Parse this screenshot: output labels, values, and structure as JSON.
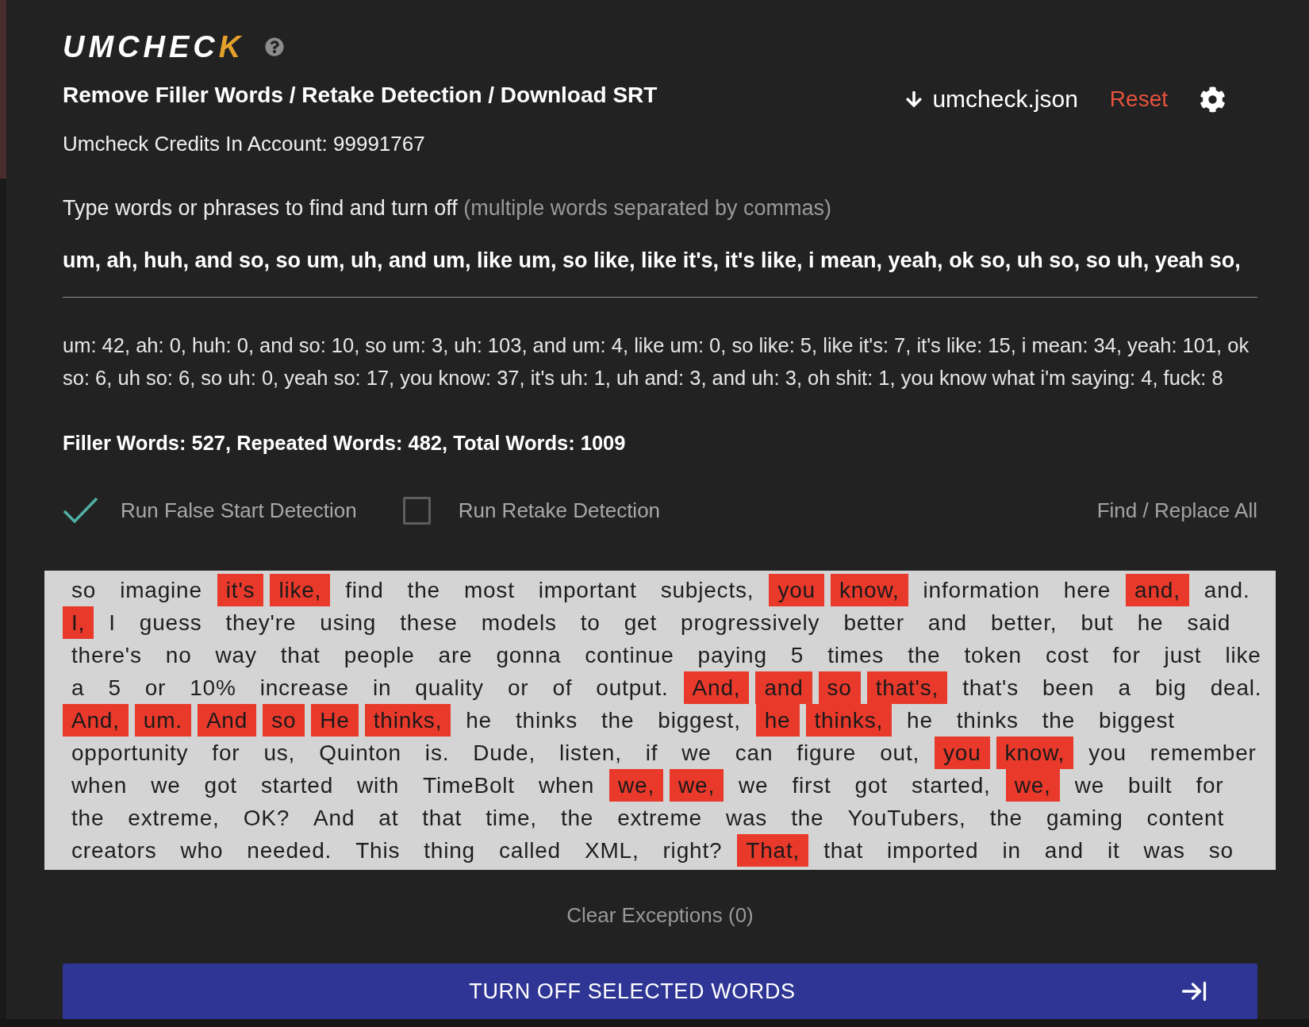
{
  "logo": {
    "text": "UMCHECK"
  },
  "header": {
    "title": "Remove Filler Words / Retake Detection / Download SRT",
    "download": {
      "label": "umcheck.json"
    },
    "reset": {
      "label": "Reset"
    }
  },
  "credits": "Umcheck Credits In Account: 99991767",
  "filter": {
    "label": "Type words or phrases to find and turn off",
    "hint": "(multiple words separated by commas)",
    "value": "um, ah, huh, and so, so um, uh, and um, like um, so like, like it's, it's like, i mean, yeah, ok so, uh so, so uh, yeah so,"
  },
  "counts": "um: 42, ah: 0, huh: 0, and so: 10, so um: 3, uh: 103, and um: 4, like um: 0, so like: 5, like it's: 7, it's like: 15, i mean: 34, yeah: 101, ok so: 6, uh so: 6, so uh: 0, yeah so: 17, you know: 37, it's uh: 1, uh and: 3, and uh: 3, oh shit: 1, you know what i'm saying: 4, fuck: 8",
  "summary": "Filler Words: 527, Repeated Words: 482, Total Words: 1009",
  "options": [
    {
      "label": "Run False Start Detection",
      "checked": true
    },
    {
      "label": "Run Retake Detection",
      "checked": false
    }
  ],
  "find_replace": "Find / Replace All",
  "transcript": {
    "lines": [
      {
        "words": [
          {
            "text": "so",
            "selected": false
          },
          {
            "text": "imagine",
            "selected": false
          },
          {
            "text": "it's",
            "selected": true
          },
          {
            "text": "like,",
            "selected": true
          },
          {
            "text": "find",
            "selected": false
          },
          {
            "text": "the",
            "selected": false
          },
          {
            "text": "most",
            "selected": false
          },
          {
            "text": "important",
            "selected": false
          },
          {
            "text": "subjects,",
            "selected": false
          },
          {
            "text": "you",
            "selected": true
          },
          {
            "text": "know,",
            "selected": true
          },
          {
            "text": "information",
            "selected": false
          },
          {
            "text": "here",
            "selected": false
          },
          {
            "text": "and,",
            "selected": true
          },
          {
            "text": "and.",
            "selected": false
          }
        ]
      },
      {
        "words": [
          {
            "text": "I,",
            "selected": true
          },
          {
            "text": "I",
            "selected": false
          },
          {
            "text": "guess",
            "selected": false
          },
          {
            "text": "they're",
            "selected": false
          },
          {
            "text": "using",
            "selected": false
          },
          {
            "text": "these",
            "selected": false
          },
          {
            "text": "models",
            "selected": false
          },
          {
            "text": "to",
            "selected": false
          },
          {
            "text": "get",
            "selected": false
          },
          {
            "text": "progressively",
            "selected": false
          },
          {
            "text": "better",
            "selected": false
          },
          {
            "text": "and",
            "selected": false
          },
          {
            "text": "better,",
            "selected": false
          },
          {
            "text": "but",
            "selected": false
          },
          {
            "text": "he",
            "selected": false
          },
          {
            "text": "said",
            "selected": false
          }
        ]
      },
      {
        "words": [
          {
            "text": "there's",
            "selected": false
          },
          {
            "text": "no",
            "selected": false
          },
          {
            "text": "way",
            "selected": false
          },
          {
            "text": "that",
            "selected": false
          },
          {
            "text": "people",
            "selected": false
          },
          {
            "text": "are",
            "selected": false
          },
          {
            "text": "gonna",
            "selected": false
          },
          {
            "text": "continue",
            "selected": false
          },
          {
            "text": "paying",
            "selected": false
          },
          {
            "text": "5",
            "selected": false
          },
          {
            "text": "times",
            "selected": false
          },
          {
            "text": "the",
            "selected": false
          },
          {
            "text": "token",
            "selected": false
          },
          {
            "text": "cost",
            "selected": false
          },
          {
            "text": "for",
            "selected": false
          },
          {
            "text": "just",
            "selected": false
          },
          {
            "text": "like",
            "selected": false
          }
        ]
      },
      {
        "words": [
          {
            "text": "a",
            "selected": false
          },
          {
            "text": "5",
            "selected": false
          },
          {
            "text": "or",
            "selected": false
          },
          {
            "text": "10%",
            "selected": false
          },
          {
            "text": "increase",
            "selected": false
          },
          {
            "text": "in",
            "selected": false
          },
          {
            "text": "quality",
            "selected": false
          },
          {
            "text": "or",
            "selected": false
          },
          {
            "text": "of",
            "selected": false
          },
          {
            "text": "output.",
            "selected": false
          },
          {
            "text": "And,",
            "selected": true
          },
          {
            "text": "and",
            "selected": true
          },
          {
            "text": "so",
            "selected": true
          },
          {
            "text": "that's,",
            "selected": true
          },
          {
            "text": "that's",
            "selected": false
          },
          {
            "text": "been",
            "selected": false
          },
          {
            "text": "a",
            "selected": false
          },
          {
            "text": "big",
            "selected": false
          },
          {
            "text": "deal.",
            "selected": false
          }
        ]
      },
      {
        "words": [
          {
            "text": "And,",
            "selected": true
          },
          {
            "text": "um.",
            "selected": true
          },
          {
            "text": "And",
            "selected": true
          },
          {
            "text": "so",
            "selected": true
          },
          {
            "text": "He",
            "selected": true
          },
          {
            "text": "thinks,",
            "selected": true
          },
          {
            "text": "he",
            "selected": false
          },
          {
            "text": "thinks",
            "selected": false
          },
          {
            "text": "the",
            "selected": false
          },
          {
            "text": "biggest,",
            "selected": false
          },
          {
            "text": "he",
            "selected": true
          },
          {
            "text": "thinks,",
            "selected": true
          },
          {
            "text": "he",
            "selected": false
          },
          {
            "text": "thinks",
            "selected": false
          },
          {
            "text": "the",
            "selected": false
          },
          {
            "text": "biggest",
            "selected": false
          }
        ]
      },
      {
        "words": [
          {
            "text": "opportunity",
            "selected": false
          },
          {
            "text": "for",
            "selected": false
          },
          {
            "text": "us,",
            "selected": false
          },
          {
            "text": "Quinton",
            "selected": false
          },
          {
            "text": "is.",
            "selected": false
          },
          {
            "text": "Dude,",
            "selected": false
          },
          {
            "text": "listen,",
            "selected": false
          },
          {
            "text": "if",
            "selected": false
          },
          {
            "text": "we",
            "selected": false
          },
          {
            "text": "can",
            "selected": false
          },
          {
            "text": "figure",
            "selected": false
          },
          {
            "text": "out,",
            "selected": false
          },
          {
            "text": "you",
            "selected": true
          },
          {
            "text": "know,",
            "selected": true
          },
          {
            "text": "you",
            "selected": false
          },
          {
            "text": "remember",
            "selected": false
          }
        ]
      },
      {
        "words": [
          {
            "text": "when",
            "selected": false
          },
          {
            "text": "we",
            "selected": false
          },
          {
            "text": "got",
            "selected": false
          },
          {
            "text": "started",
            "selected": false
          },
          {
            "text": "with",
            "selected": false
          },
          {
            "text": "TimeBolt",
            "selected": false
          },
          {
            "text": "when",
            "selected": false
          },
          {
            "text": "we,",
            "selected": true
          },
          {
            "text": "we,",
            "selected": true
          },
          {
            "text": "we",
            "selected": false
          },
          {
            "text": "first",
            "selected": false
          },
          {
            "text": "got",
            "selected": false
          },
          {
            "text": "started,",
            "selected": false
          },
          {
            "text": "we,",
            "selected": true
          },
          {
            "text": "we",
            "selected": false
          },
          {
            "text": "built",
            "selected": false
          },
          {
            "text": "for",
            "selected": false
          }
        ]
      },
      {
        "words": [
          {
            "text": "the",
            "selected": false
          },
          {
            "text": "extreme,",
            "selected": false
          },
          {
            "text": "OK?",
            "selected": false
          },
          {
            "text": "And",
            "selected": false
          },
          {
            "text": "at",
            "selected": false
          },
          {
            "text": "that",
            "selected": false
          },
          {
            "text": "time,",
            "selected": false
          },
          {
            "text": "the",
            "selected": false
          },
          {
            "text": "extreme",
            "selected": false
          },
          {
            "text": "was",
            "selected": false
          },
          {
            "text": "the",
            "selected": false
          },
          {
            "text": "YouTubers,",
            "selected": false
          },
          {
            "text": "the",
            "selected": false
          },
          {
            "text": "gaming",
            "selected": false
          },
          {
            "text": "content",
            "selected": false
          }
        ]
      },
      {
        "words": [
          {
            "text": "creators",
            "selected": false
          },
          {
            "text": "who",
            "selected": false
          },
          {
            "text": "needed.",
            "selected": false
          },
          {
            "text": "This",
            "selected": false
          },
          {
            "text": "thing",
            "selected": false
          },
          {
            "text": "called",
            "selected": false
          },
          {
            "text": "XML,",
            "selected": false
          },
          {
            "text": "right?",
            "selected": false
          },
          {
            "text": "That,",
            "selected": true
          },
          {
            "text": "that",
            "selected": false
          },
          {
            "text": "imported",
            "selected": false
          },
          {
            "text": "in",
            "selected": false
          },
          {
            "text": "and",
            "selected": false
          },
          {
            "text": "it",
            "selected": false
          },
          {
            "text": "was",
            "selected": false
          },
          {
            "text": "so",
            "selected": false
          }
        ]
      }
    ]
  },
  "clear_exceptions": "Clear Exceptions (0)",
  "submit": "TURN OFF SELECTED WORDS"
}
